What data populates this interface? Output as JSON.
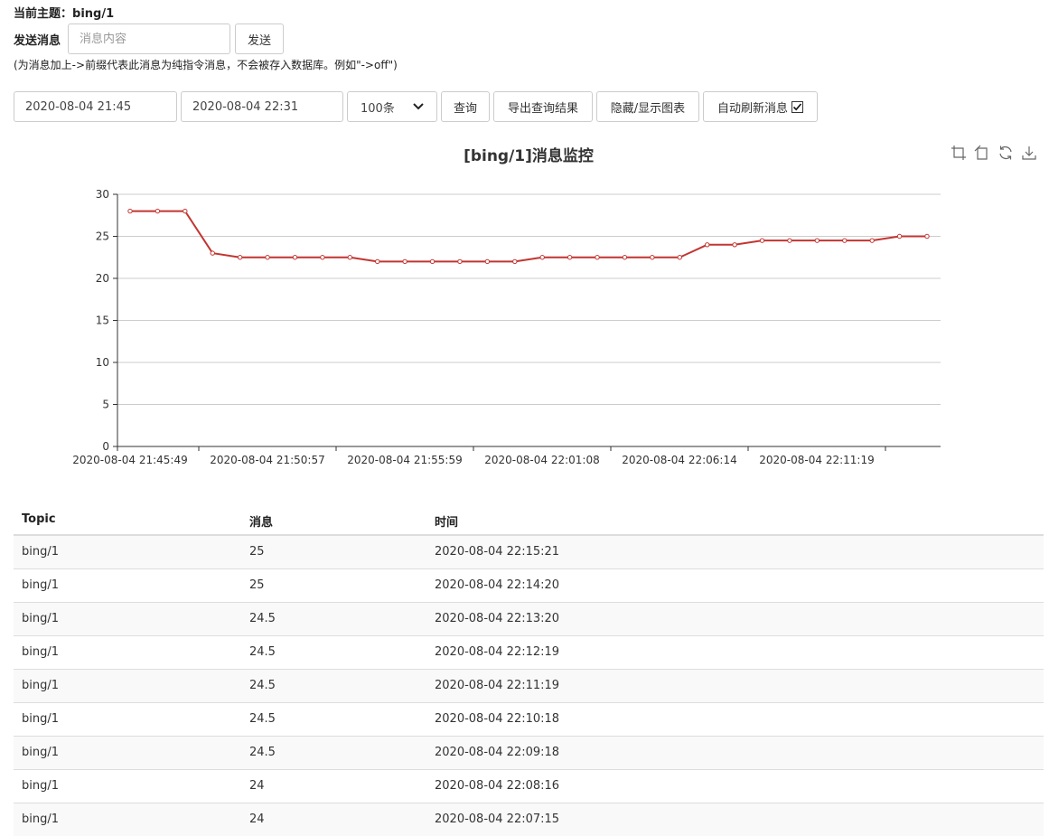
{
  "header": {
    "topic_label": "当前主题：",
    "topic_value": "bing/1",
    "send_label": "发送消息",
    "message_placeholder": "消息内容",
    "message_value": "",
    "send_button": "发送",
    "hint": "(为消息加上->前缀代表此消息为纯指令消息，不会被存入数据库。例如\"->off\")"
  },
  "query": {
    "start_time": "2020-08-04 21:45",
    "end_time": "2020-08-04 22:31",
    "limit_selected": "100条",
    "query_button": "查询",
    "export_button": "导出查询结果",
    "toggle_chart_button": "隐藏/显示图表",
    "auto_refresh_label": "自动刷新消息",
    "auto_refresh_checked": true
  },
  "chart_data": {
    "type": "line",
    "title": "[bing/1]消息监控",
    "xlabel": "",
    "ylabel": "",
    "ylim": [
      0,
      30
    ],
    "y_ticks": [
      "0",
      "5",
      "10",
      "15",
      "20",
      "25",
      "30"
    ],
    "x_tick_labels": [
      "2020-08-04 21:45:49",
      "2020-08-04 21:50:57",
      "2020-08-04 21:55:59",
      "2020-08-04 22:01:08",
      "2020-08-04 22:06:14",
      "2020-08-04 22:11:19"
    ],
    "series": [
      {
        "color": "#c23531",
        "values": [
          28,
          28,
          28,
          23,
          22.5,
          22.5,
          22.5,
          22.5,
          22.5,
          22,
          22,
          22,
          22,
          22,
          22,
          22.5,
          22.5,
          22.5,
          22.5,
          22.5,
          22.5,
          24,
          24,
          24.5,
          24.5,
          24.5,
          24.5,
          24.5,
          25,
          25
        ]
      }
    ],
    "grid": true
  },
  "table": {
    "headers": [
      "Topic",
      "消息",
      "时间"
    ],
    "rows": [
      [
        "bing/1",
        "25",
        "2020-08-04 22:15:21"
      ],
      [
        "bing/1",
        "25",
        "2020-08-04 22:14:20"
      ],
      [
        "bing/1",
        "24.5",
        "2020-08-04 22:13:20"
      ],
      [
        "bing/1",
        "24.5",
        "2020-08-04 22:12:19"
      ],
      [
        "bing/1",
        "24.5",
        "2020-08-04 22:11:19"
      ],
      [
        "bing/1",
        "24.5",
        "2020-08-04 22:10:18"
      ],
      [
        "bing/1",
        "24.5",
        "2020-08-04 22:09:18"
      ],
      [
        "bing/1",
        "24",
        "2020-08-04 22:08:16"
      ],
      [
        "bing/1",
        "24",
        "2020-08-04 22:07:15"
      ]
    ]
  },
  "toolbox_icons": [
    "zoom-icon",
    "zoom-reset-icon",
    "restore-icon",
    "save-image-icon"
  ]
}
